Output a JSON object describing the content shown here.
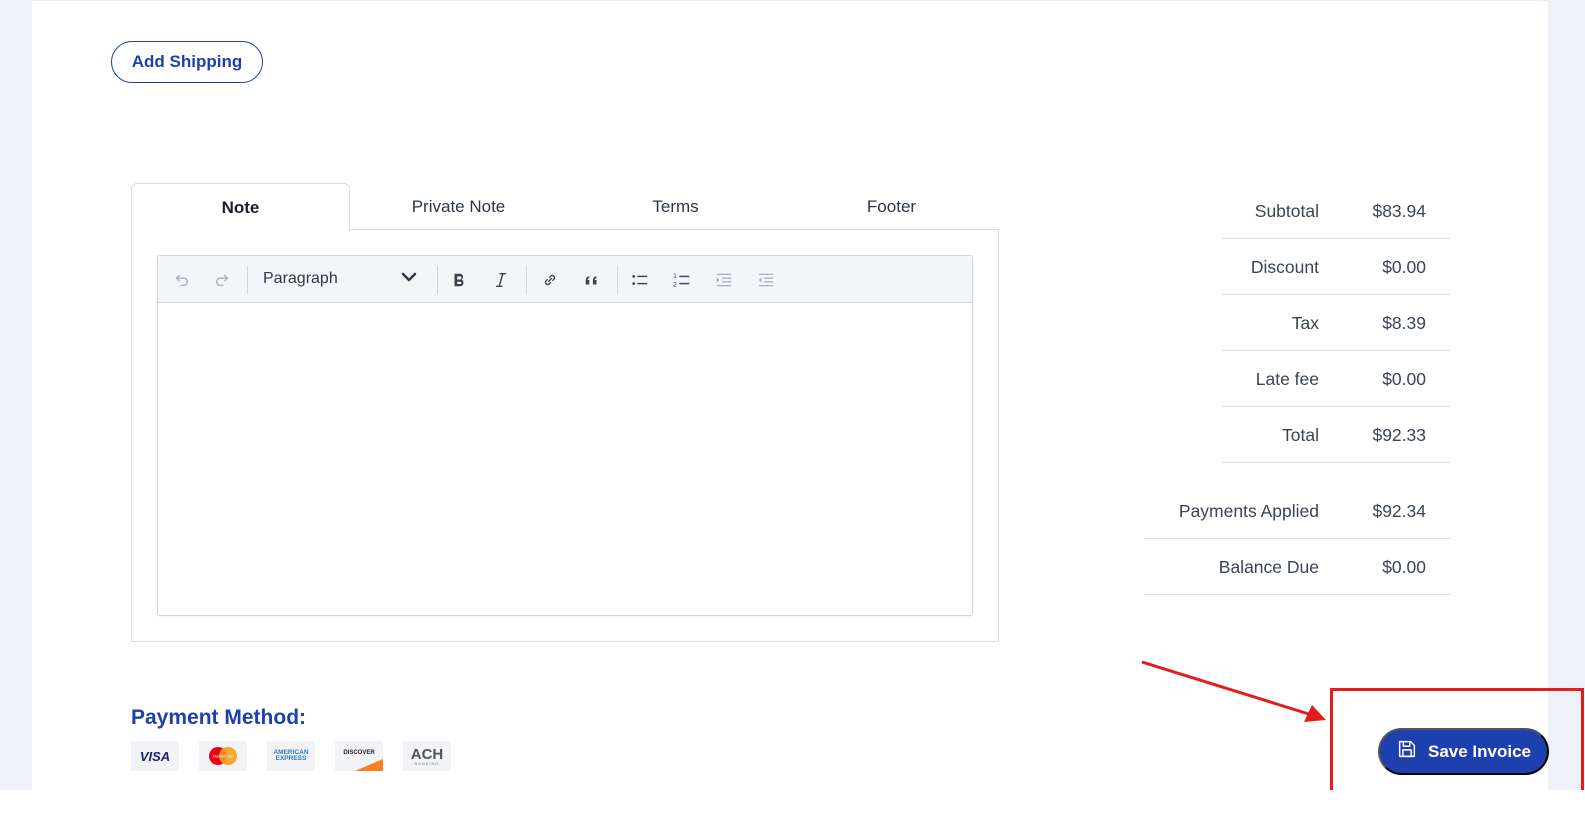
{
  "shipping": {
    "add_label": "Add Shipping"
  },
  "tabs": [
    {
      "label": "Note",
      "active": true
    },
    {
      "label": "Private Note",
      "active": false
    },
    {
      "label": "Terms",
      "active": false
    },
    {
      "label": "Footer",
      "active": false
    }
  ],
  "editor": {
    "block_format": "Paragraph",
    "toolbar_icons": [
      "undo-icon",
      "redo-icon",
      "bold-icon",
      "italic-icon",
      "link-icon",
      "blockquote-icon",
      "bulleted-list-icon",
      "numbered-list-icon",
      "indent-icon",
      "outdent-icon"
    ],
    "content": ""
  },
  "summary": {
    "rows": [
      {
        "label": "Subtotal",
        "value": "$83.94"
      },
      {
        "label": "Discount",
        "value": "$0.00"
      },
      {
        "label": "Tax",
        "value": "$8.39"
      },
      {
        "label": "Late fee",
        "value": "$0.00"
      },
      {
        "label": "Total",
        "value": "$92.33"
      },
      {
        "label": "Payments Applied",
        "value": "$92.34"
      },
      {
        "label": "Balance Due",
        "value": "$0.00"
      }
    ]
  },
  "payment": {
    "title": "Payment Method:",
    "cards": [
      {
        "name": "visa",
        "logo_text": "VISA"
      },
      {
        "name": "mastercard",
        "logo_text": "MasterCard"
      },
      {
        "name": "american-express",
        "logo_text": "AMERICAN EXPRESS"
      },
      {
        "name": "discover",
        "logo_text": "DISCOVER"
      },
      {
        "name": "ach",
        "logo_text": "ACH",
        "sub_text": "BANKING"
      }
    ]
  },
  "actions": {
    "save_label": "Save Invoice"
  },
  "colors": {
    "primary": "#1e40af",
    "annotation_red": "#e11d1d",
    "panel_border": "#d9dde3",
    "page_background": "#eef1f6"
  }
}
